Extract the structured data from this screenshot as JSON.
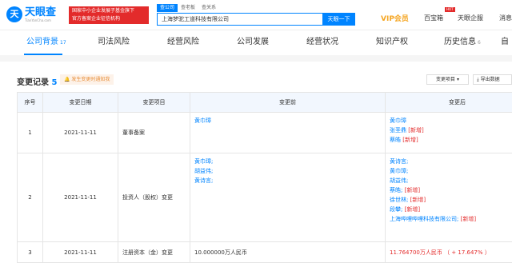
{
  "header": {
    "logo_icon": "天",
    "logo_text": "天眼查",
    "logo_sub": "TianYanCha.com",
    "badge_line1": "国家中小企业发展子基金旗下",
    "badge_line2": "官方备案企业征信机构",
    "search_tabs": [
      "查公司",
      "查老板",
      "查关系"
    ],
    "search_value": "上海梦驼工道科技有限公司",
    "search_button": "天眼一下",
    "vip": "VIP会员",
    "nav": [
      "百宝箱",
      "天眼企服",
      "消息"
    ],
    "hot": "HOT"
  },
  "tabs": [
    {
      "label": "公司背景",
      "count": "17"
    },
    {
      "label": "司法风险",
      "count": ""
    },
    {
      "label": "经营风险",
      "count": ""
    },
    {
      "label": "公司发展",
      "count": ""
    },
    {
      "label": "经营状况",
      "count": ""
    },
    {
      "label": "知识产权",
      "count": ""
    },
    {
      "label": "历史信息",
      "count": "6"
    },
    {
      "label": "自",
      "count": ""
    }
  ],
  "section": {
    "title": "变更记录",
    "count": "5",
    "warning": "发生变更时通知我",
    "filter_button": "变更项目",
    "export_button": "导出数据"
  },
  "table": {
    "headers": [
      "序号",
      "变更日期",
      "变更项目",
      "变更前",
      "变更后"
    ],
    "new_tag": "[新增]",
    "rows": [
      {
        "index": "1",
        "date": "2021-11-11",
        "item": "董事备案",
        "before": [
          "黄巾璋"
        ],
        "after": [
          {
            "name": "黄巾璋",
            "new": false
          },
          {
            "name": "张圣鼎",
            "new": true
          },
          {
            "name": "蔡皓",
            "new": true
          }
        ]
      },
      {
        "index": "2",
        "date": "2021-11-11",
        "item": "投资人（股权）变更",
        "before": [
          "黄巾璋;",
          "胡益伟;",
          "黄诗言;"
        ],
        "after": [
          {
            "name": "黄诗言;",
            "new": false
          },
          {
            "name": "黄巾璋;",
            "new": false
          },
          {
            "name": "胡益伟;",
            "new": false
          },
          {
            "name": "蔡皓;",
            "new": true
          },
          {
            "name": "徐世林;",
            "new": true
          },
          {
            "name": "段攀;",
            "new": true
          },
          {
            "name": "上海哔哩哔哩科技有限公司;",
            "new": true
          }
        ]
      },
      {
        "index": "3",
        "date": "2021-11-11",
        "item": "注册资本（金）变更",
        "before_text": "10.000000万人民币",
        "after_text": "11.764700万人民币 （ + 17.647% ）"
      }
    ]
  }
}
